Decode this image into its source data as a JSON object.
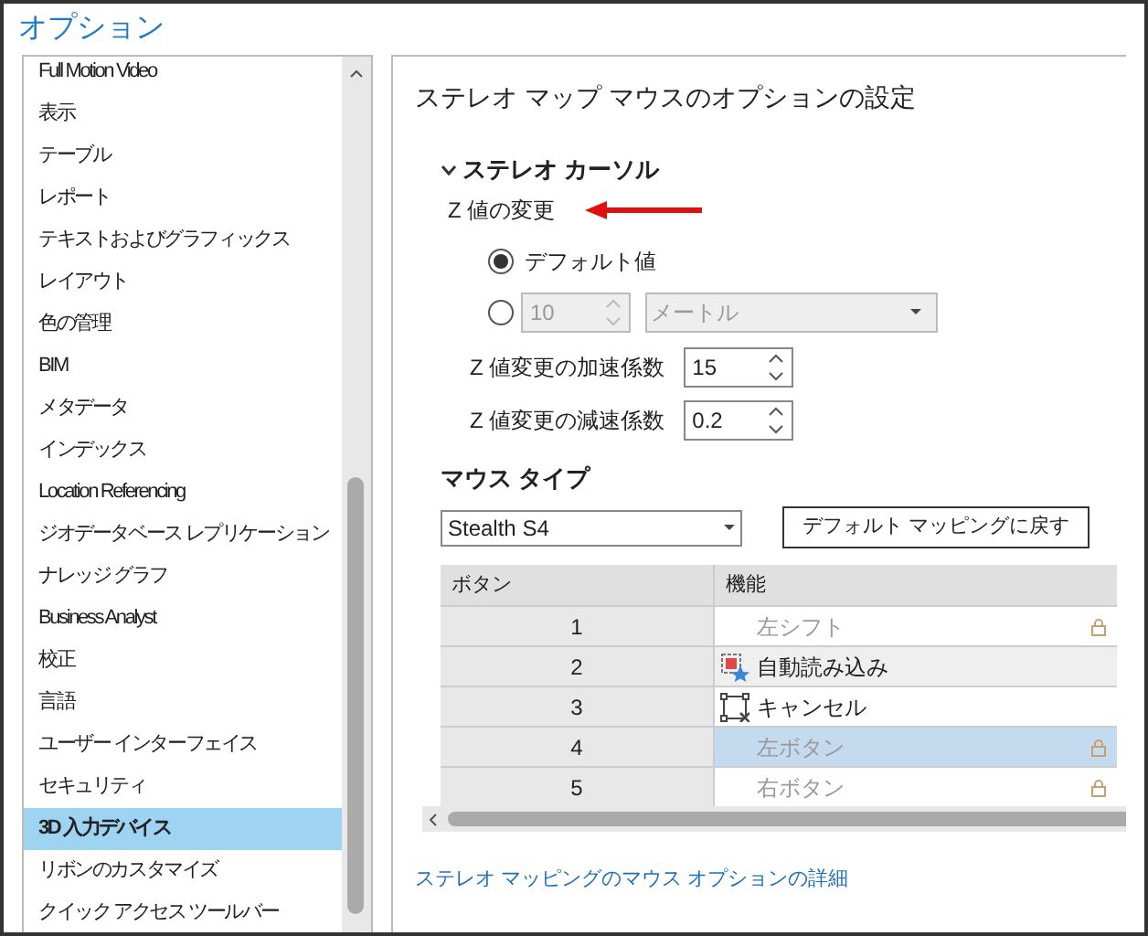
{
  "window": {
    "title": "オプション"
  },
  "sidebar": {
    "items": [
      {
        "label": "Full Motion Video",
        "selected": false
      },
      {
        "label": "表示",
        "selected": false
      },
      {
        "label": "テーブル",
        "selected": false
      },
      {
        "label": "レポート",
        "selected": false
      },
      {
        "label": "テキストおよびグラフィックス",
        "selected": false
      },
      {
        "label": "レイアウト",
        "selected": false
      },
      {
        "label": "色の管理",
        "selected": false
      },
      {
        "label": "BIM",
        "selected": false
      },
      {
        "label": "メタデータ",
        "selected": false
      },
      {
        "label": "インデックス",
        "selected": false
      },
      {
        "label": "Location Referencing",
        "selected": false
      },
      {
        "label": "ジオデータベース レプリケーション",
        "selected": false
      },
      {
        "label": "ナレッジ グラフ",
        "selected": false
      },
      {
        "label": "Business Analyst",
        "selected": false
      },
      {
        "label": "校正",
        "selected": false
      },
      {
        "label": "言語",
        "selected": false
      },
      {
        "label": "ユーザー インターフェイス",
        "selected": false
      },
      {
        "label": "セキュリティ",
        "selected": false
      },
      {
        "label": "3D 入力デバイス",
        "selected": true
      },
      {
        "label": "リボンのカスタマイズ",
        "selected": false
      },
      {
        "label": "クイック アクセス ツールバー",
        "selected": false
      }
    ]
  },
  "panel": {
    "heading": "ステレオ マップ マウスのオプションの設定",
    "section": {
      "title": "ステレオ カーソル",
      "expanded": true
    },
    "z_change": {
      "label": "Z 値の変更",
      "options": [
        {
          "label": "デフォルト値",
          "selected": true
        },
        {
          "selected": false,
          "value": "10",
          "unit": "メートル",
          "disabled": true
        }
      ]
    },
    "acceleration": {
      "label": "Z 値変更の加速係数",
      "value": "15"
    },
    "deceleration": {
      "label": "Z 値変更の減速係数",
      "value": "0.2"
    },
    "mouse_type": {
      "label": "マウス タイプ",
      "value": "Stealth S4"
    },
    "reset_button": "デフォルト マッピングに戻す",
    "table": {
      "columns": [
        "ボタン",
        "機能"
      ],
      "rows": [
        {
          "button": "1",
          "function": "左シフト",
          "kind": "locked",
          "selected": false
        },
        {
          "button": "2",
          "function": "自動読み込み",
          "kind": "load",
          "selected": false
        },
        {
          "button": "3",
          "function": "キャンセル",
          "kind": "cancel",
          "selected": false
        },
        {
          "button": "4",
          "function": "左ボタン",
          "kind": "locked",
          "selected": true
        },
        {
          "button": "5",
          "function": "右ボタン",
          "kind": "locked",
          "selected": false
        }
      ]
    },
    "link": "ステレオ マッピングのマウス オプションの詳細"
  }
}
